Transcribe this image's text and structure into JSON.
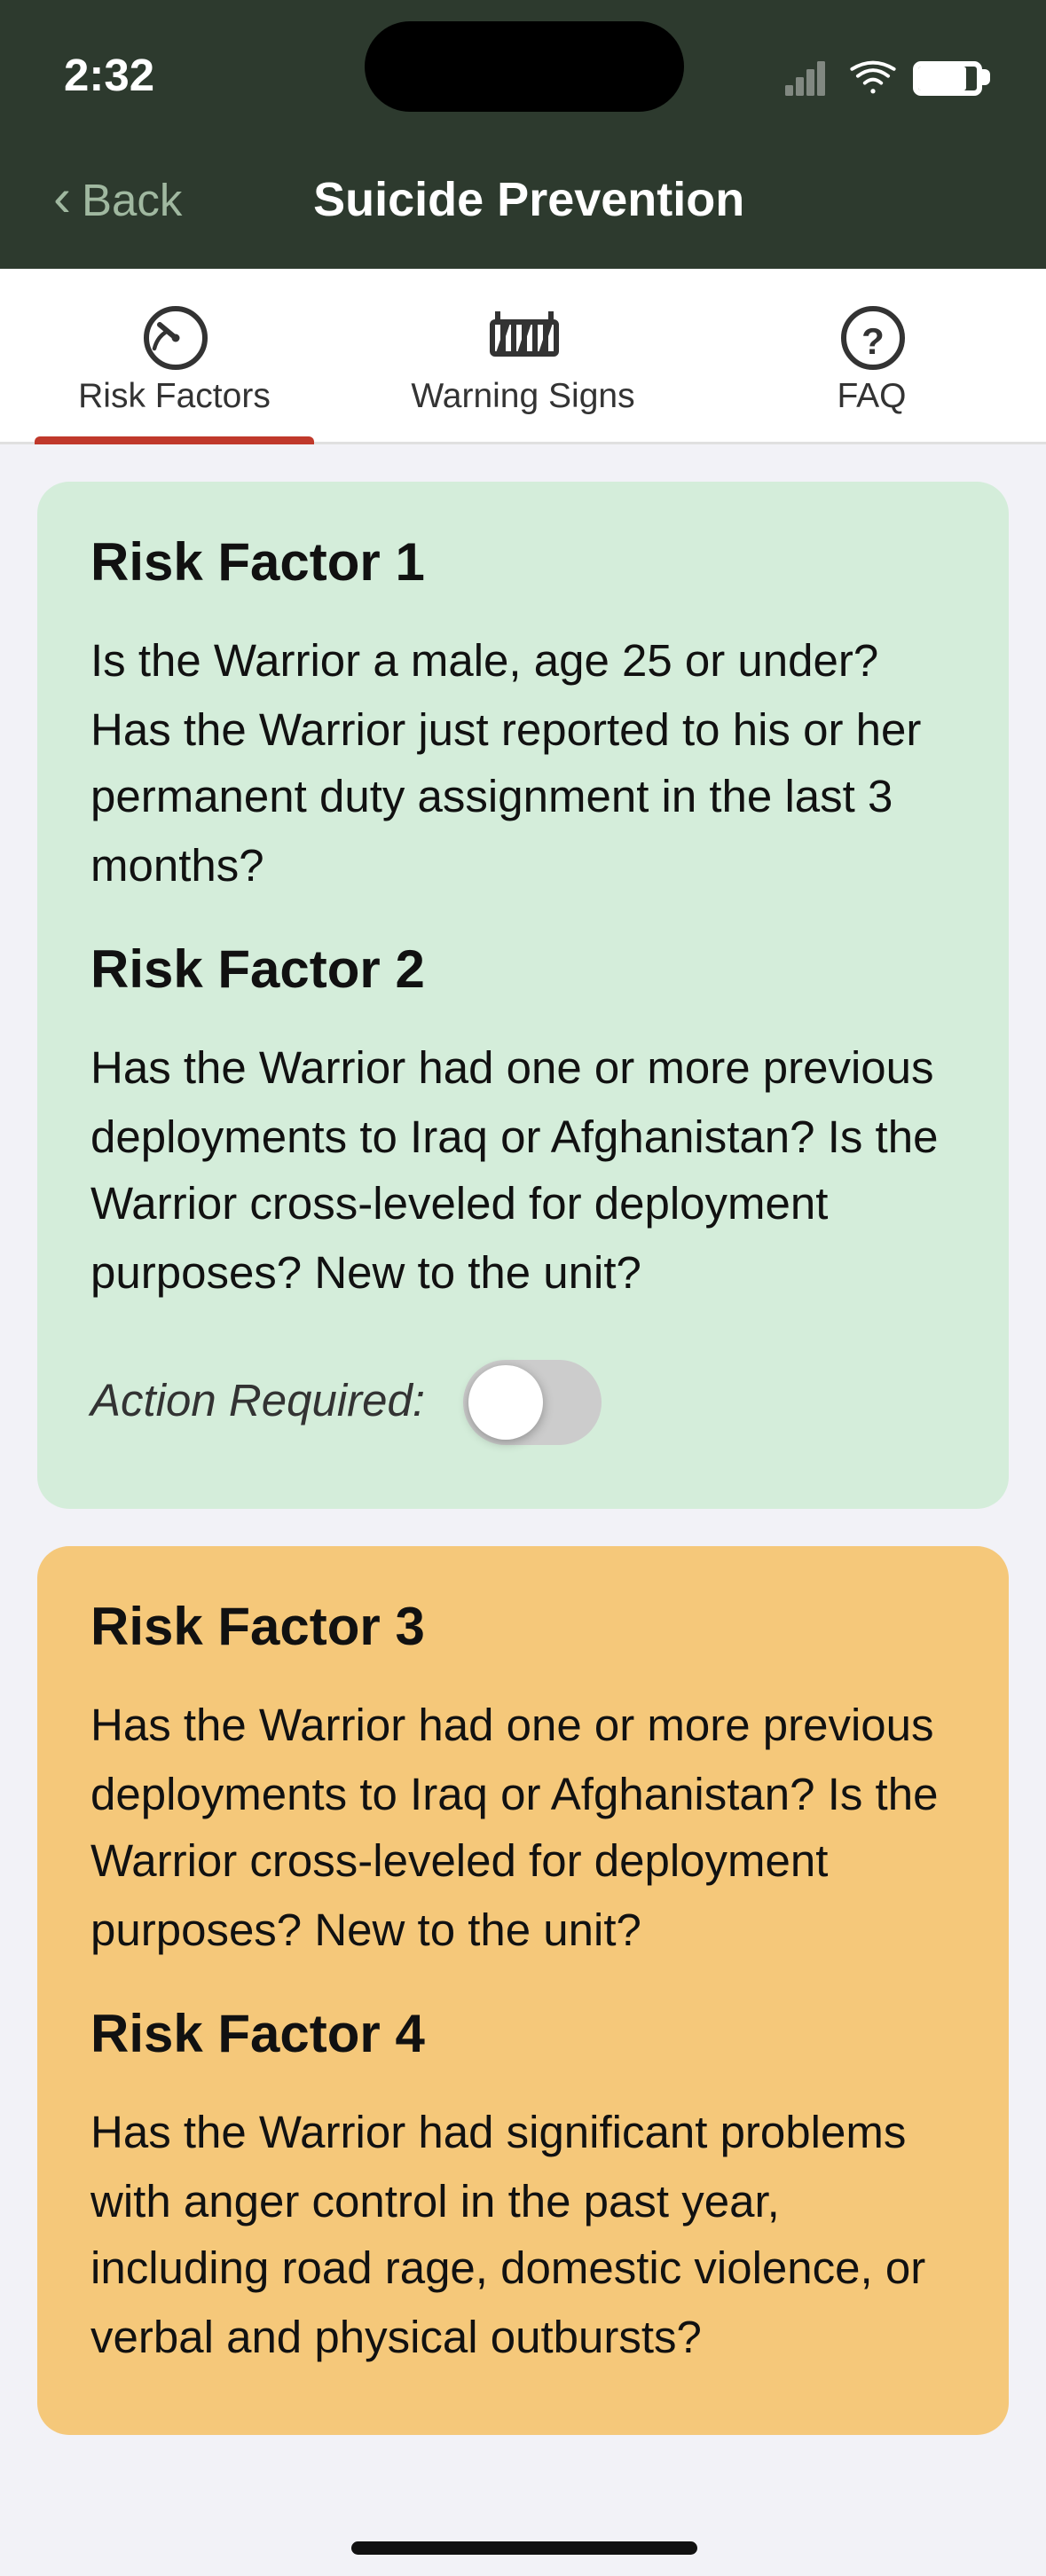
{
  "statusBar": {
    "time": "2:32"
  },
  "navBar": {
    "backLabel": "Back",
    "title": "Suicide Prevention"
  },
  "tabs": [
    {
      "id": "risk-factors",
      "label": "Risk Factors",
      "active": true,
      "icon": "gauge"
    },
    {
      "id": "warning-signs",
      "label": "Warning Signs",
      "active": false,
      "icon": "barrier"
    },
    {
      "id": "faq",
      "label": "FAQ",
      "active": false,
      "icon": "question"
    }
  ],
  "cards": [
    {
      "id": "card-green",
      "color": "green",
      "factors": [
        {
          "title": "Risk Factor 1",
          "text": "Is the Warrior a male, age 25 or under? Has the Warrior just reported to his or her permanent duty assignment in the last 3 months?"
        },
        {
          "title": "Risk Factor 2",
          "text": "Has the Warrior had one or more previous deployments to Iraq or Afghanistan? Is the Warrior cross-leveled for deployment purposes? New to the unit?"
        }
      ],
      "actionLabel": "Action Required:",
      "toggleState": false
    },
    {
      "id": "card-orange",
      "color": "orange",
      "factors": [
        {
          "title": "Risk Factor 3",
          "text": "Has the Warrior had one or more previous deployments to Iraq or Afghanistan? Is the Warrior cross-leveled for deployment purposes? New to the unit?"
        },
        {
          "title": "Risk Factor 4",
          "text": "Has the Warrior had significant problems with anger control in the past year, including road rage, domestic violence, or verbal and physical outbursts?"
        }
      ]
    }
  ],
  "homeIndicator": {}
}
